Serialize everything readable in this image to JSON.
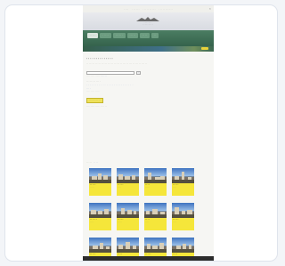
{
  "topbar": {
    "links": [
      "· · · ·",
      "· · · · · ·",
      "· · · · · · · · · ·",
      "· · · · · · · · · · ·"
    ],
    "close": "×"
  },
  "banner": {
    "logo_text": "· · · · · · ·",
    "sub_text": "· · · · · · · · ·"
  },
  "nav": {
    "tabs": [
      "· · · · ·",
      "· · · · ·",
      "· · · · · ·",
      "· · · · ·",
      "· · · ·",
      "· ·"
    ]
  },
  "content": {
    "title": "· · · · · · · · · · · · · ·",
    "intro": "· · · · · · · · · · · · · · · · · · · · · · · · · · · · · · · · · · · · · · · · · · · · · · · · ·",
    "search_placeholder": "",
    "search_button": "·",
    "hint": "· · · · · · · · · · · · · ·",
    "hint_link": "· · · · ·",
    "section_label": "· · · · · · · · · · · ·",
    "letters": [
      "·",
      "·",
      "·",
      "·",
      "·",
      "·",
      "·",
      "·",
      "·",
      "·",
      "·",
      "·",
      "·",
      "·",
      "·",
      "·",
      "·",
      "·",
      "·",
      "·",
      "·",
      "·",
      "·",
      "·",
      "·",
      "·"
    ],
    "small_link": "· · · ·",
    "note": "· · · · · · · · · · · · ·",
    "yellow_button": "· · · · · · · · · ·",
    "caption": "· · · · · · · · · · · · · · · · · · ·"
  },
  "gallery": {
    "tabs": [
      "· · · · ·",
      "· · · ·"
    ],
    "cards": [
      {
        "name": "· · · · ·",
        "sub": "· · · · ·"
      },
      {
        "name": "· · · · ·",
        "sub": "· · · ·"
      },
      {
        "name": "· · · ·",
        "sub": "· · · · ·"
      },
      {
        "name": "· · · · ·",
        "sub": "· · · ·"
      },
      {
        "name": "· · · · · ·",
        "sub": "· · · ·"
      },
      {
        "name": "· · · · ·",
        "sub": "· · · · ·"
      },
      {
        "name": "· · · ·",
        "sub": "· · · ·"
      },
      {
        "name": "· · · · ·",
        "sub": "· · · ·"
      },
      {
        "name": "· · · · ·",
        "sub": "· · · ·"
      },
      {
        "name": "· · · ·",
        "sub": "· · · · ·"
      },
      {
        "name": "· · · · ·",
        "sub": "· · · ·"
      },
      {
        "name": "· · · ·",
        "sub": "· · · ·"
      }
    ]
  },
  "colors": {
    "page_bg": "#f3f5f8",
    "nav_green": "#2d5a45",
    "card_yellow": "#f5e63a",
    "link_blue": "#2a4fb0"
  }
}
